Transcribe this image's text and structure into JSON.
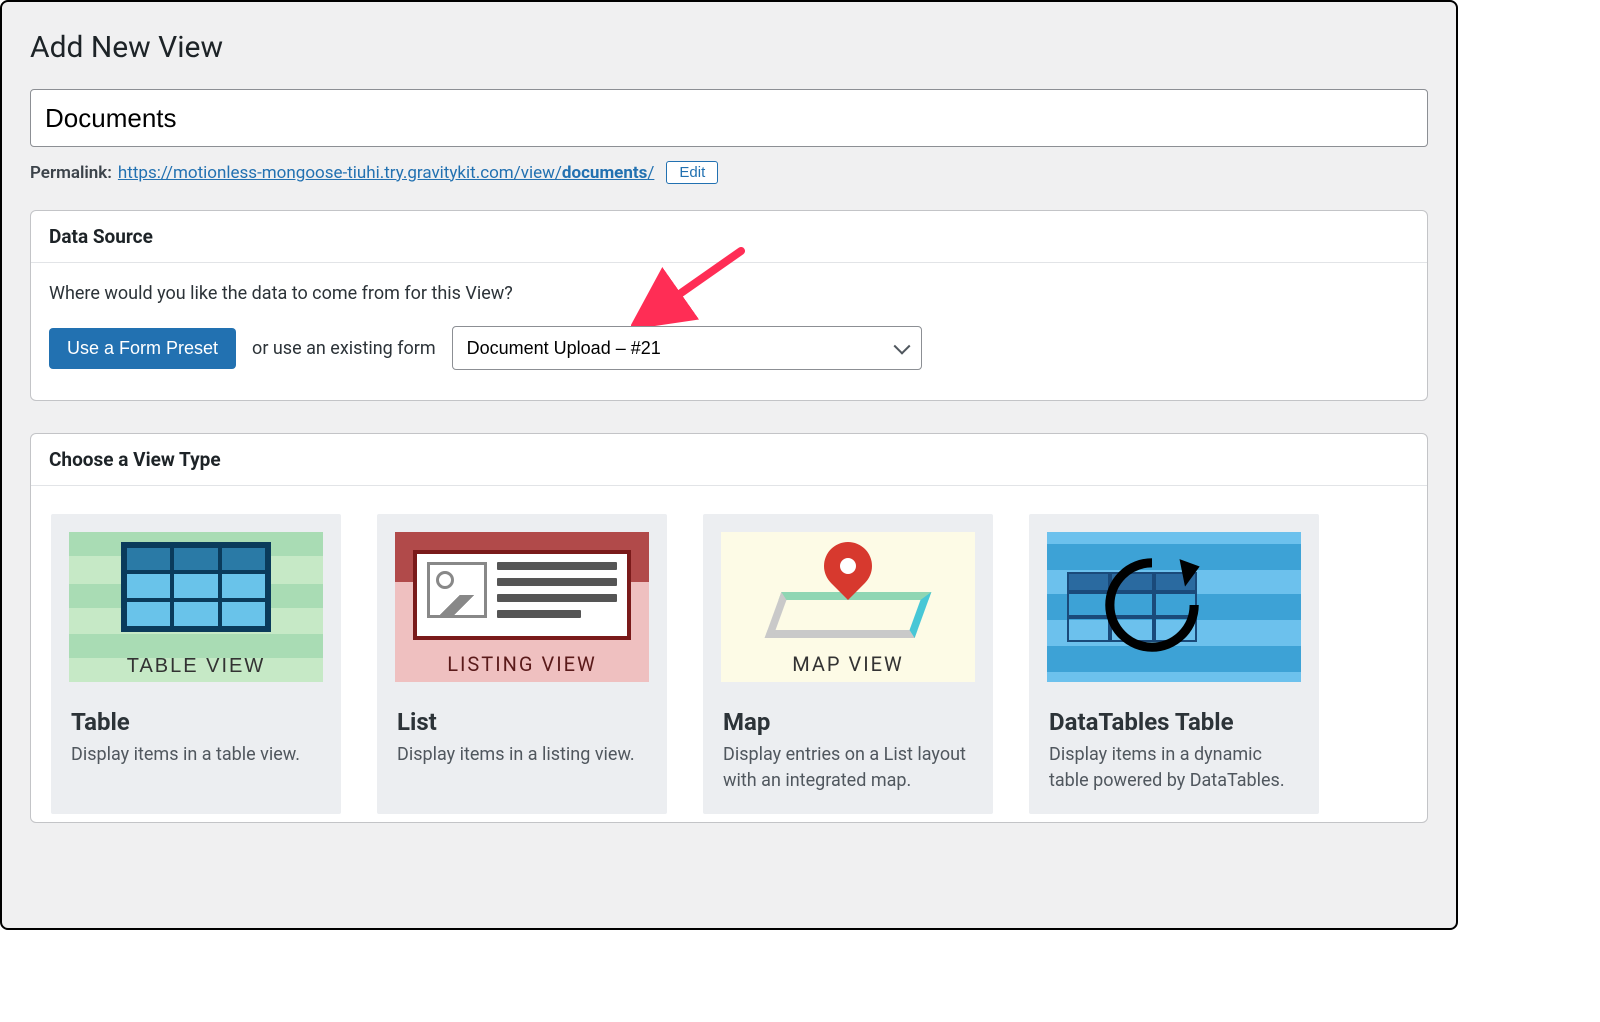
{
  "page": {
    "title": "Add New View"
  },
  "title_input": {
    "value": "Documents"
  },
  "permalink": {
    "label": "Permalink:",
    "url_prefix": "https://motionless-mongoose-tiuhi.try.gravitykit.com/view/",
    "url_slug": "documents",
    "url_suffix": "/",
    "edit_label": "Edit"
  },
  "data_source": {
    "heading": "Data Source",
    "question": "Where would you like the data to come from for this View?",
    "preset_button": "Use a Form Preset",
    "or_text": "or use an existing form",
    "selected_form": "Document Upload – #21"
  },
  "view_types": {
    "heading": "Choose a View Type",
    "cards": [
      {
        "title": "Table",
        "desc": "Display items in a table view.",
        "thumb_label": "TABLE VIEW"
      },
      {
        "title": "List",
        "desc": "Display items in a listing view.",
        "thumb_label": "LISTING VIEW"
      },
      {
        "title": "Map",
        "desc": "Display entries on a List layout with an integrated map.",
        "thumb_label": "MAP VIEW"
      },
      {
        "title": "DataTables Table",
        "desc": "Display items in a dynamic table powered by DataTables.",
        "thumb_label": ""
      }
    ]
  }
}
